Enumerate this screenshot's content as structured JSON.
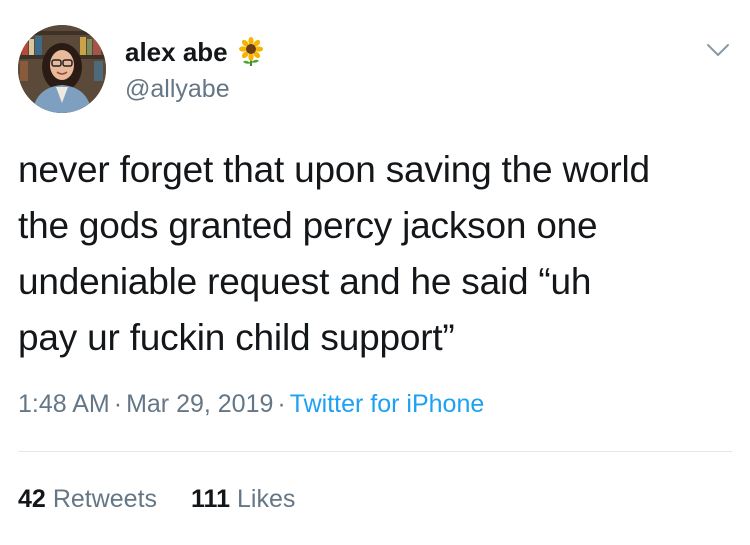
{
  "user": {
    "display_name": "alex abe",
    "handle": "@allyabe",
    "name_emoji": "sunflower-icon"
  },
  "tweet": {
    "lines": [
      "never forget that upon saving the world",
      "the gods granted percy jackson one",
      "undeniable request and he said “uh",
      "pay ur fuckin child support”"
    ],
    "time": "1:48 AM",
    "date": "Mar 29, 2019",
    "separator": "·",
    "source": "Twitter for iPhone"
  },
  "stats": {
    "retweets_count": "42",
    "retweets_label": "Retweets",
    "likes_count": "111",
    "likes_label": "Likes"
  },
  "colors": {
    "text": "#14171a",
    "secondary": "#657786",
    "link": "#1da1f2",
    "divider": "#e1e8ed"
  }
}
